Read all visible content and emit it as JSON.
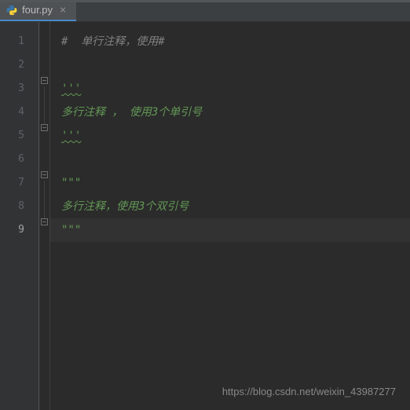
{
  "tab": {
    "filename": "four.py",
    "icon": "python-icon"
  },
  "gutter": {
    "line_numbers": [
      "1",
      "2",
      "3",
      "4",
      "5",
      "6",
      "7",
      "8",
      "9"
    ],
    "active_line_index": 8
  },
  "code": {
    "lines": [
      {
        "text": "#  单行注释，使用#",
        "class": "comment"
      },
      {
        "text": "",
        "class": ""
      },
      {
        "text": "'''",
        "class": "docstring wavy"
      },
      {
        "text": "多行注释 ， 使用3个单引号",
        "class": "docstring"
      },
      {
        "text": "'''",
        "class": "docstring wavy"
      },
      {
        "text": "",
        "class": ""
      },
      {
        "text": "\"\"\"",
        "class": "docstring"
      },
      {
        "text": "多行注释，使用3个双引号",
        "class": "docstring"
      },
      {
        "text": "\"\"\"",
        "class": "docstring"
      }
    ]
  },
  "watermark": "https://blog.csdn.net/weixin_43987277"
}
